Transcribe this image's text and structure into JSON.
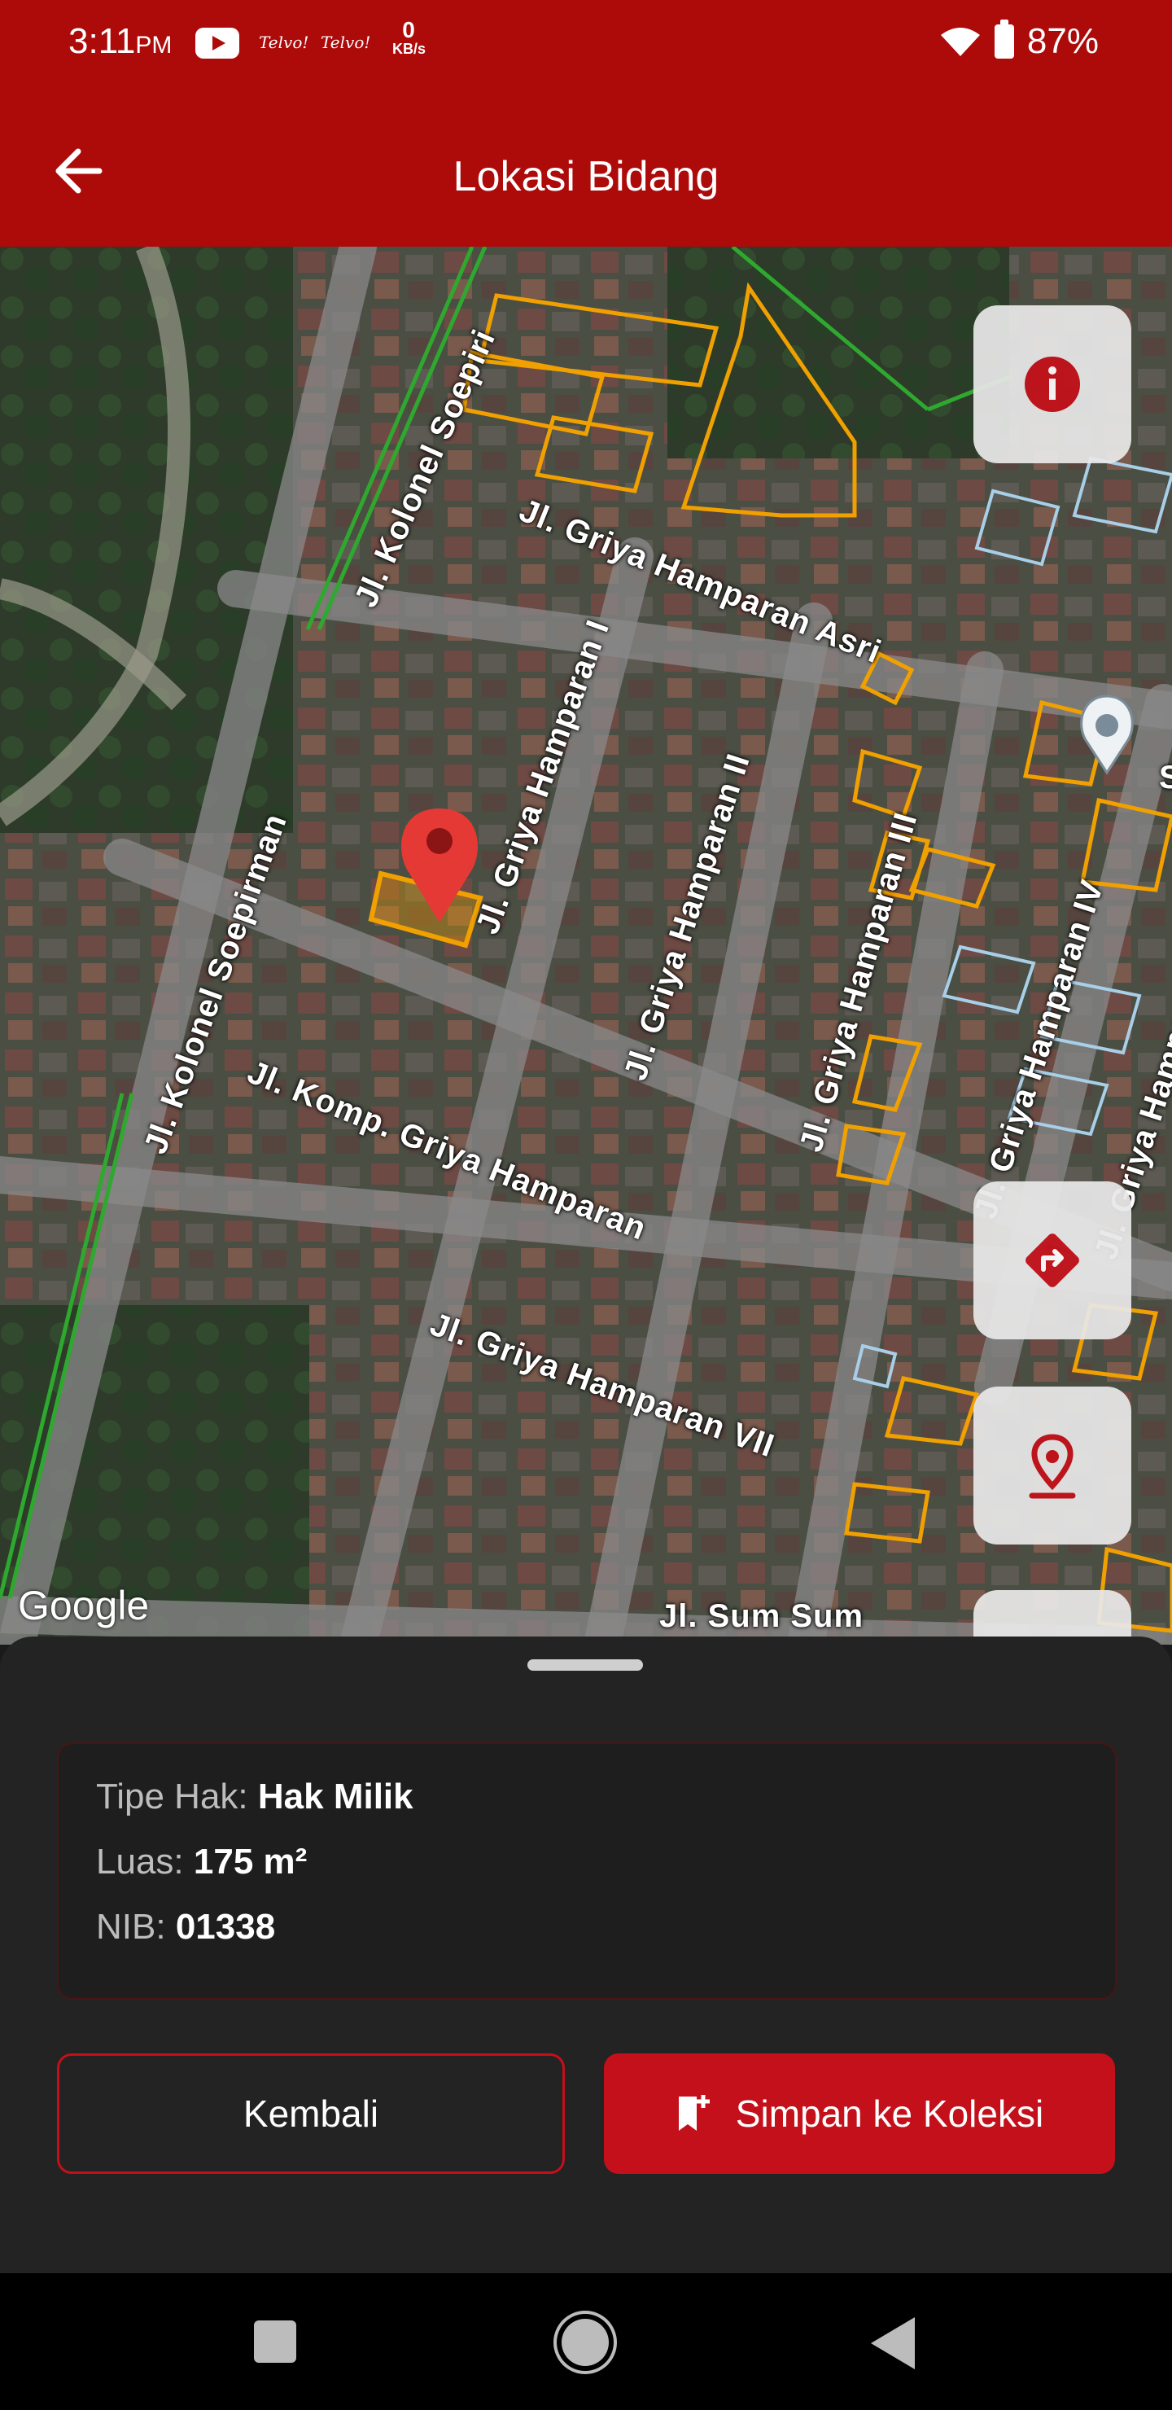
{
  "status_bar": {
    "time": "3:11",
    "ampm": "PM",
    "carrier1": "Telvo!",
    "carrier2": "Telvo!",
    "speed_value": "0",
    "speed_unit": "KB/s",
    "battery": "87%"
  },
  "app_bar": {
    "title": "Lokasi Bidang",
    "back_icon": "arrow-left-icon"
  },
  "map": {
    "attribution": "Google",
    "road_labels": [
      "Jl. Kolonel Soepiri",
      "Jl. Griya Hamparan Asri",
      "Jl. Griya Hamparan I",
      "Jl. Griya Hamparan II",
      "Jl. Griya Hamparan III",
      "Jl. Griya Hamparan IV",
      "Jl. Kolonel Soepirman",
      "Jl. Komp. Griya Hamparan",
      "Jl. Griya Hamparan VII",
      "Jl. Griya Hampa",
      "Sum",
      "Jl. Sum Sum"
    ],
    "controls": [
      "info-icon",
      "directions-icon",
      "location-pin-icon"
    ]
  },
  "parcel_info": {
    "tipe_hak_label": "Tipe Hak:",
    "tipe_hak_value": "Hak Milik",
    "luas_label": "Luas:",
    "luas_value": "175 m²",
    "nib_label": "NIB:",
    "nib_value": "01338"
  },
  "actions": {
    "back_label": "Kembali",
    "save_label": "Simpan ke Koleksi"
  },
  "colors": {
    "primary": "#ad0a0a",
    "button": "#c4101a",
    "parcel_outline": "#f0a000",
    "sheet": "#232323"
  }
}
